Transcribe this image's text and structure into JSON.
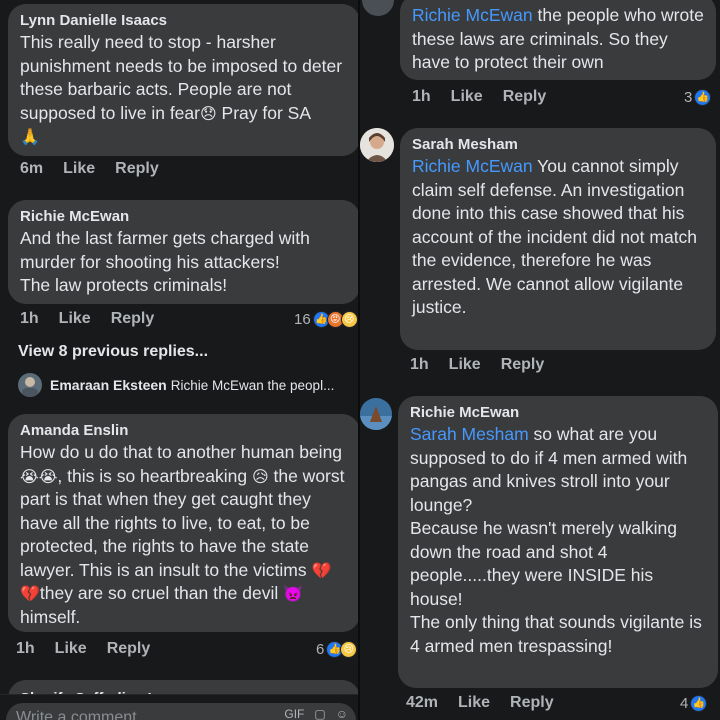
{
  "left": {
    "c1": {
      "author": "Lynn Danielle Isaacs",
      "text": "This really need to stop - harsher punishment needs to be imposed to deter these barbaric acts. People are not supposed to live in fear",
      "emoji1": "😞",
      "tail": " Pray for SA",
      "emoji2": "🙏",
      "time": "6m",
      "like": "Like",
      "reply": "Reply"
    },
    "c2": {
      "author": "Richie McEwan",
      "line1": "And the last farmer gets charged with",
      "line2": "murder for shooting his attackers!",
      "line3": "The law protects criminals!",
      "time": "1h",
      "like": "Like",
      "reply": "Reply",
      "reaction_count": "16"
    },
    "view_previous": "View 8 previous replies...",
    "reply_preview": {
      "author": "Emaraan Eksteen",
      "text": "Richie McEwan the peopl..."
    },
    "c3": {
      "author": "Amanda Enslin",
      "t1": "How do u do that to another human being",
      "e1": "😭😭",
      "t2": ", this is so heartbreaking ",
      "e2": "😥",
      "t3": " the worst part is that when they get caught they have all the rights to live, to eat, to be protected, the rights to have the state lawyer. This is an insult to the victims ",
      "e3": "💔💔",
      "t4": "they are so cruel than the devil ",
      "e4": "👿",
      "t5": " himself.",
      "time": "1h",
      "like": "Like",
      "reply": "Reply",
      "reaction_count": "6"
    },
    "c4_author_partial": "Sharifa Saffodien Loomon",
    "write_placeholder": "Write a comment..."
  },
  "right": {
    "c1": {
      "mention": "Richie McEwan",
      "text": " the people who wrote these laws are criminals. So they have to protect their own",
      "time": "1h",
      "like": "Like",
      "reply": "Reply",
      "reaction_count": "3"
    },
    "c2": {
      "author": "Sarah Mesham",
      "mention": "Richie McEwan",
      "text": " You cannot simply claim self defense. An investigation done into this case showed that his account of the incident did not match the evidence, therefore he was arrested. We cannot allow vigilante justice.",
      "time": "1h",
      "like": "Like",
      "reply": "Reply"
    },
    "c3": {
      "author": "Richie McEwan",
      "mention": "Sarah Mesham",
      "p1": " so what are you supposed to do if 4 men armed with pangas and knives stroll into your lounge?",
      "p2": "Because he wasn't merely walking down the road and shot 4 people.....they were INSIDE his house!",
      "p3": "The only thing that sounds vigilante is 4 armed men trespassing!",
      "time": "42m",
      "like": "Like",
      "reply": "Reply",
      "reaction_count": "4"
    }
  },
  "colors": {
    "bg": "#18191a",
    "bubble": "#3a3b3c",
    "mention": "#4599ff",
    "like_blue": "#2078f4"
  }
}
